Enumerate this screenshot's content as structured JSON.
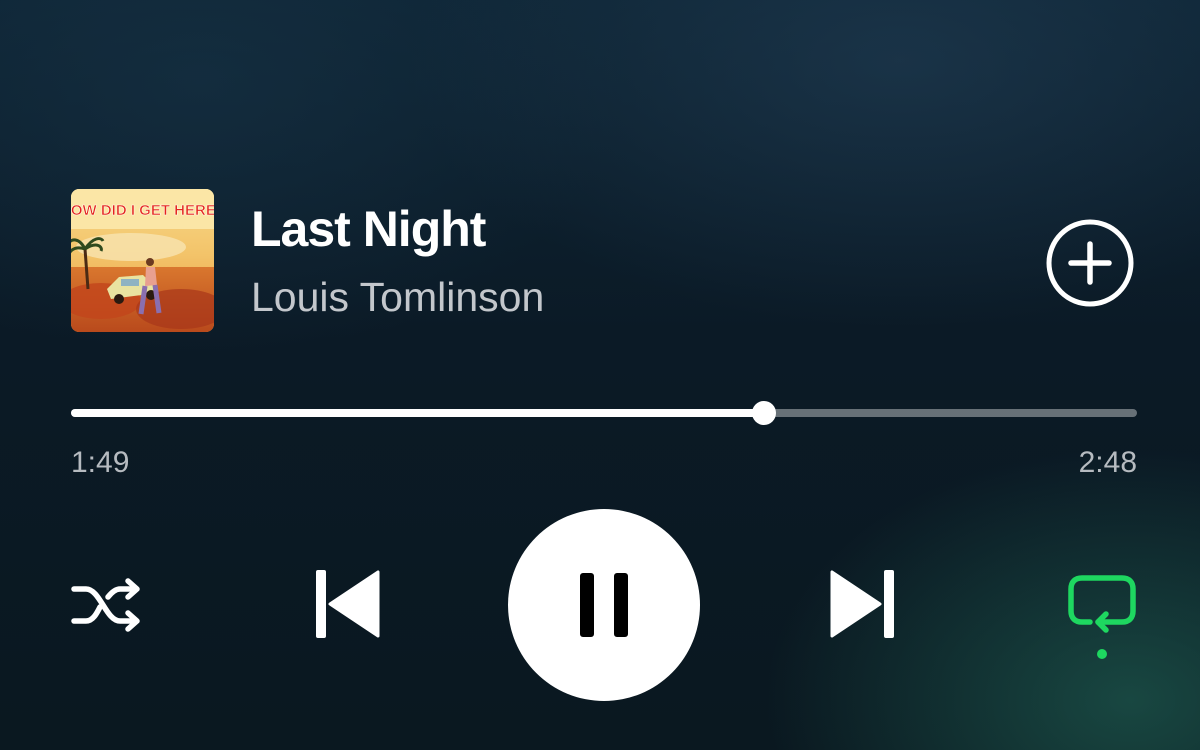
{
  "track": {
    "title": "Last Night",
    "artist": "Louis Tomlinson",
    "album_art_text": "HOW DID I GET HERE?"
  },
  "playback": {
    "elapsed": "1:49",
    "duration": "2:48",
    "progress_fraction": 0.65,
    "state": "playing",
    "repeat_active": true,
    "shuffle_active": false
  },
  "icons": {
    "add": "add-circle-icon",
    "shuffle": "shuffle-icon",
    "previous": "skip-previous-icon",
    "pause": "pause-icon",
    "next": "skip-next-icon",
    "repeat": "repeat-icon"
  },
  "colors": {
    "accent": "#1ed760",
    "text_primary": "#ffffff",
    "text_secondary": "#c3c7cc"
  }
}
